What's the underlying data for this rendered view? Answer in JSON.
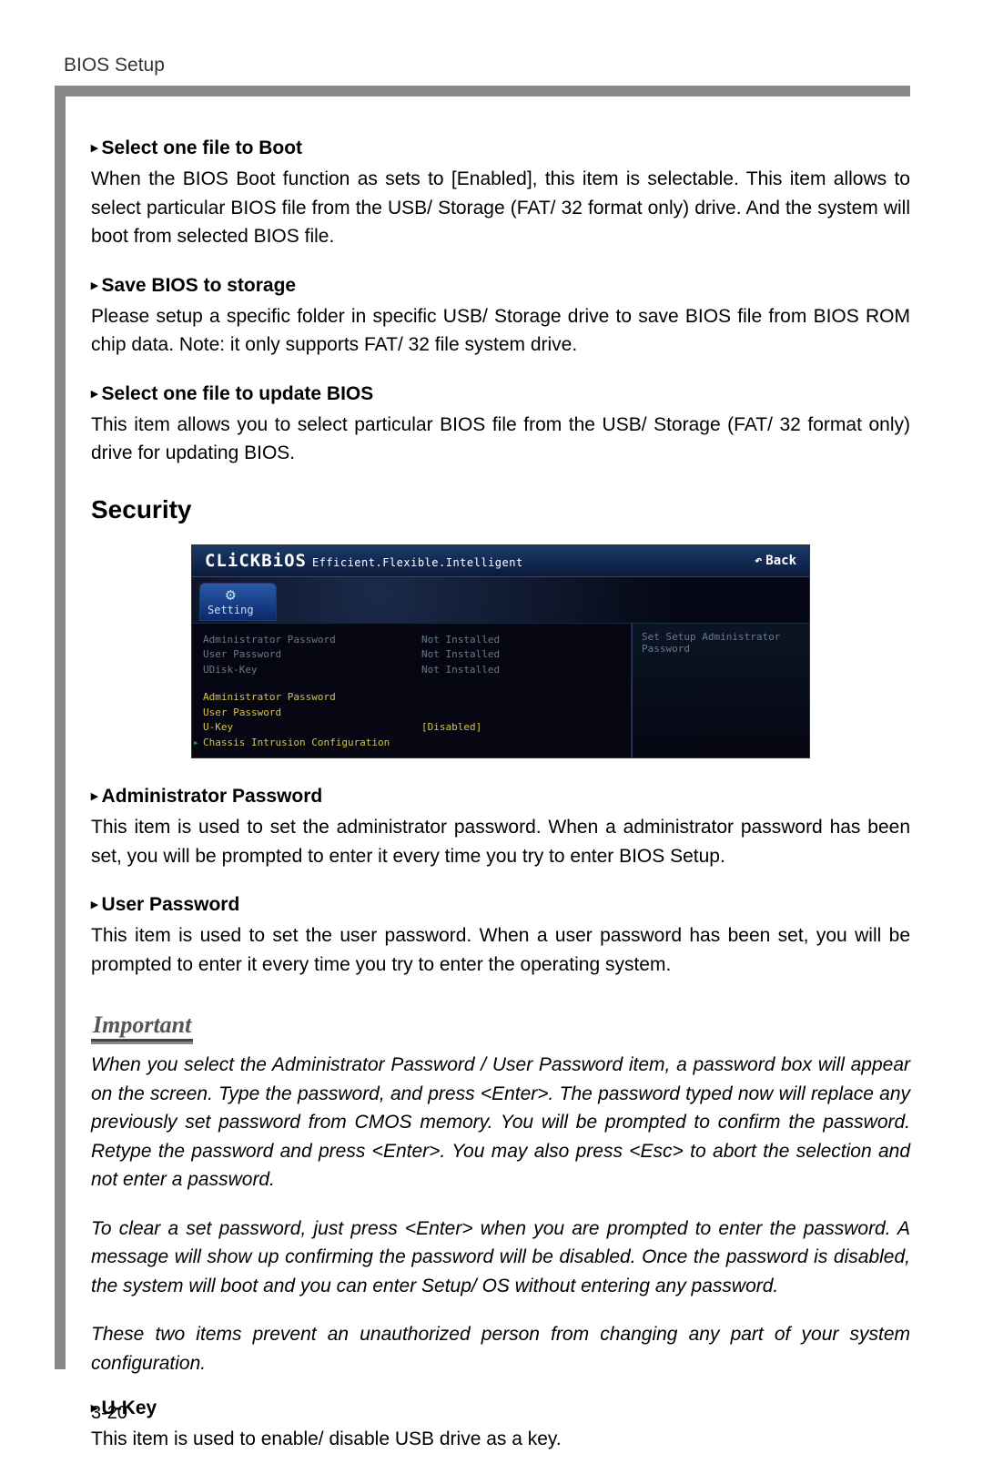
{
  "header": {
    "title": "BIOS Setup"
  },
  "items_top": [
    {
      "title": "Select one file to Boot",
      "body": "When the BIOS Boot function as sets to [Enabled], this item is selectable. This item allows to select particular BIOS file from the USB/ Storage (FAT/ 32 format only) drive. And the system will boot from selected BIOS file."
    },
    {
      "title": "Save BIOS to storage",
      "body": "Please setup a specific folder in specific USB/ Storage drive to save BIOS file from BIOS ROM chip data. Note: it only supports FAT/ 32 file system drive."
    },
    {
      "title": "Select one file to update BIOS",
      "body": "This item allows you to select particular BIOS file from the USB/ Storage (FAT/ 32 format only) drive for updating BIOS."
    }
  ],
  "section_heading": "Security",
  "bios": {
    "brand": "CLiCKBiOS",
    "tagline": "Efficient.Flexible.Intelligent",
    "back": "Back",
    "tab": "Setting",
    "status": [
      {
        "label": "Administrator Password",
        "value": "Not Installed"
      },
      {
        "label": "User Password",
        "value": "Not Installed"
      },
      {
        "label": "UDisk-Key",
        "value": "Not Installed"
      }
    ],
    "menu": [
      {
        "label": "Administrator Password",
        "value": ""
      },
      {
        "label": "User Password",
        "value": ""
      },
      {
        "label": "U-Key",
        "value": "[Disabled]"
      },
      {
        "label": "Chassis Intrusion Configuration",
        "value": "",
        "selected": true
      }
    ],
    "help": "Set Setup Administrator Password"
  },
  "items_bottom": [
    {
      "title": "Administrator Password",
      "body": "This item is used to set the administrator password. When a administrator password has been set, you will be prompted to enter it every time you try to enter BIOS Setup."
    },
    {
      "title": "User Password",
      "body": "This item is used to set the user password. When a user password has been set, you will be prompted to enter it every time you try to enter the operating system."
    }
  ],
  "important": {
    "label": "Important",
    "paragraphs": [
      "When you select the Administrator Password / User Password item, a password box will appear on the screen. Type the password, and press <Enter>. The password typed now will replace any previously set password from CMOS memory. You will be prompted to confirm the password. Retype the password and press <Enter>. You may also press <Esc> to abort the selection and not enter a password.",
      "To clear a set password, just press <Enter> when you are prompted to enter the password. A message will show up confirming the password will be disabled. Once the password is disabled, the system will boot and you can enter Setup/ OS without entering any password.",
      "These two items prevent an unauthorized person from changing any part of your system configuration."
    ]
  },
  "items_tail": [
    {
      "title": "U-Key",
      "body": "This item is used to enable/ disable USB drive as a key."
    }
  ],
  "page_number": "3-20"
}
